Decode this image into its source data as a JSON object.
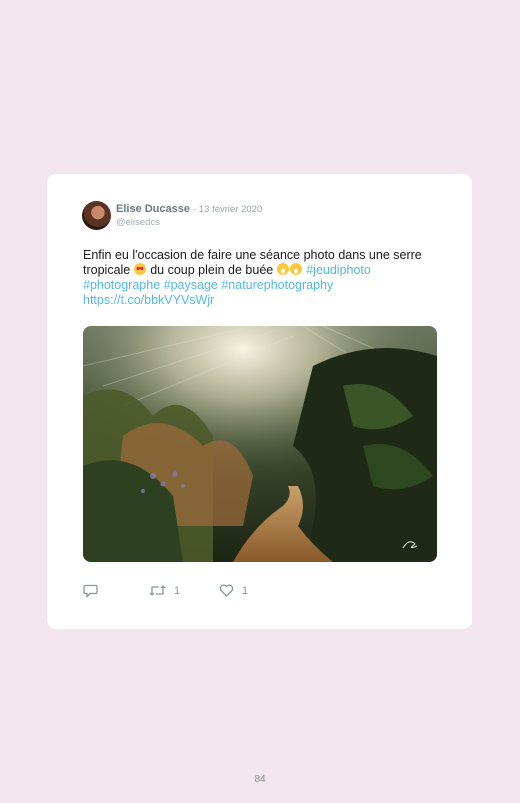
{
  "tweet": {
    "author_name": "Elise Ducasse",
    "date": "· 13 février 2020",
    "handle": "@elisedcs",
    "text_part1": "Enfin eu l'occasion de faire une séance photo dans une serre tropicale",
    "text_part2": "du coup plein de buée",
    "hashtag1": "#jeudiphoto",
    "hashtag2": "#photographe",
    "hashtag3": "#paysage",
    "hashtag4": "#naturephotography",
    "link": "https://t.co/bbkVYVsWjr",
    "retweet_count": "1",
    "like_count": "1"
  },
  "icons": {
    "avatar": "profile-photo",
    "reply": "reply-icon",
    "retweet": "retweet-icon",
    "like": "heart-icon"
  },
  "colors": {
    "background": "#f4e6ed",
    "card": "#ffffff",
    "link": "#55b8e8",
    "icon": "#8a97a3"
  },
  "page_number": "84"
}
